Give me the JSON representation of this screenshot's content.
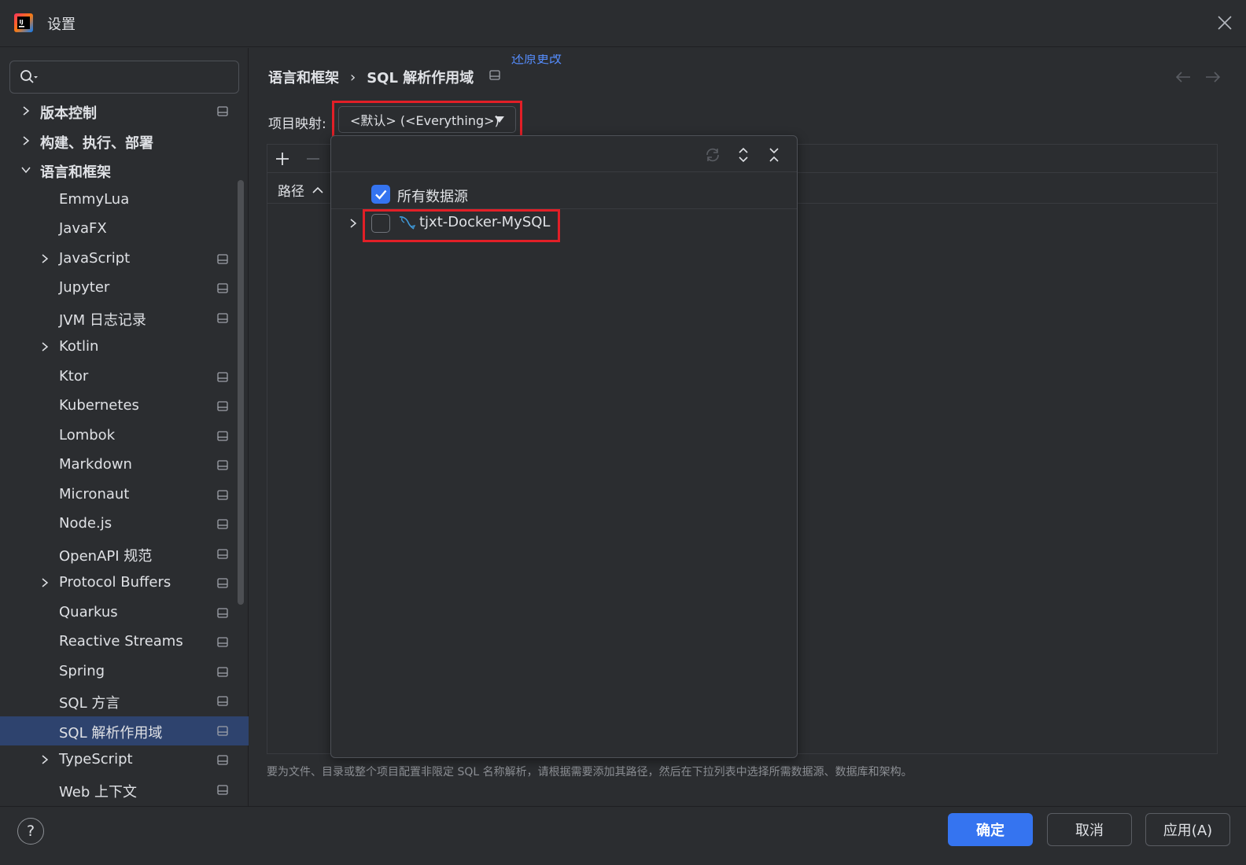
{
  "window": {
    "title": "设置"
  },
  "search": {
    "value": "",
    "placeholder": ""
  },
  "sidebar": {
    "items": [
      {
        "label": "版本控制",
        "level": 0,
        "expandable": true,
        "expanded": false,
        "pinned": true,
        "bold": true
      },
      {
        "label": "构建、执行、部署",
        "level": 0,
        "expandable": true,
        "expanded": false,
        "pinned": false,
        "bold": true
      },
      {
        "label": "语言和框架",
        "level": 0,
        "expandable": true,
        "expanded": true,
        "pinned": false,
        "bold": true
      },
      {
        "label": "EmmyLua",
        "level": 1,
        "expandable": false,
        "pinned": false
      },
      {
        "label": "JavaFX",
        "level": 1,
        "expandable": false,
        "pinned": false
      },
      {
        "label": "JavaScript",
        "level": 1,
        "expandable": true,
        "expanded": false,
        "pinned": true
      },
      {
        "label": "Jupyter",
        "level": 1,
        "expandable": false,
        "pinned": true
      },
      {
        "label": "JVM 日志记录",
        "level": 1,
        "expandable": false,
        "pinned": true
      },
      {
        "label": "Kotlin",
        "level": 1,
        "expandable": true,
        "expanded": false,
        "pinned": false
      },
      {
        "label": "Ktor",
        "level": 1,
        "expandable": false,
        "pinned": true
      },
      {
        "label": "Kubernetes",
        "level": 1,
        "expandable": false,
        "pinned": true
      },
      {
        "label": "Lombok",
        "level": 1,
        "expandable": false,
        "pinned": true
      },
      {
        "label": "Markdown",
        "level": 1,
        "expandable": false,
        "pinned": true
      },
      {
        "label": "Micronaut",
        "level": 1,
        "expandable": false,
        "pinned": true
      },
      {
        "label": "Node.js",
        "level": 1,
        "expandable": false,
        "pinned": true
      },
      {
        "label": "OpenAPI 规范",
        "level": 1,
        "expandable": false,
        "pinned": true
      },
      {
        "label": "Protocol Buffers",
        "level": 1,
        "expandable": true,
        "expanded": false,
        "pinned": true
      },
      {
        "label": "Quarkus",
        "level": 1,
        "expandable": false,
        "pinned": true
      },
      {
        "label": "Reactive Streams",
        "level": 1,
        "expandable": false,
        "pinned": true
      },
      {
        "label": "Spring",
        "level": 1,
        "expandable": false,
        "pinned": true
      },
      {
        "label": "SQL 方言",
        "level": 1,
        "expandable": false,
        "pinned": true
      },
      {
        "label": "SQL 解析作用域",
        "level": 1,
        "expandable": false,
        "pinned": true,
        "selected": true
      },
      {
        "label": "TypeScript",
        "level": 1,
        "expandable": true,
        "expanded": false,
        "pinned": true
      },
      {
        "label": "Web 上下文",
        "level": 1,
        "expandable": false,
        "pinned": true
      }
    ]
  },
  "breadcrumb": {
    "parent": "语言和框架",
    "separator": "›",
    "current": "SQL 解析作用域",
    "revert_link": "还原更改"
  },
  "mapping": {
    "label": "项目映射:",
    "selected": "<默认> (<Everything>)"
  },
  "table": {
    "path_header": "路径"
  },
  "popup": {
    "all_sources": {
      "label": "所有数据源",
      "checked": true
    },
    "datasources": [
      {
        "label": "tjxt-Docker-MySQL",
        "checked": false,
        "icon": "mysql-dolphin-icon"
      }
    ]
  },
  "footnote": "要为文件、目录或整个项目配置非限定 SQL 名称解析，请根据需要添加其路径，然后在下拉列表中选择所需数据源、数据库和架构。",
  "buttons": {
    "ok": "确定",
    "cancel": "取消",
    "apply": "应用(A)",
    "help": "?"
  },
  "colors": {
    "accent": "#3574f0",
    "selection": "#2e436e",
    "highlight_box": "#e21f27",
    "link": "#548af7"
  }
}
